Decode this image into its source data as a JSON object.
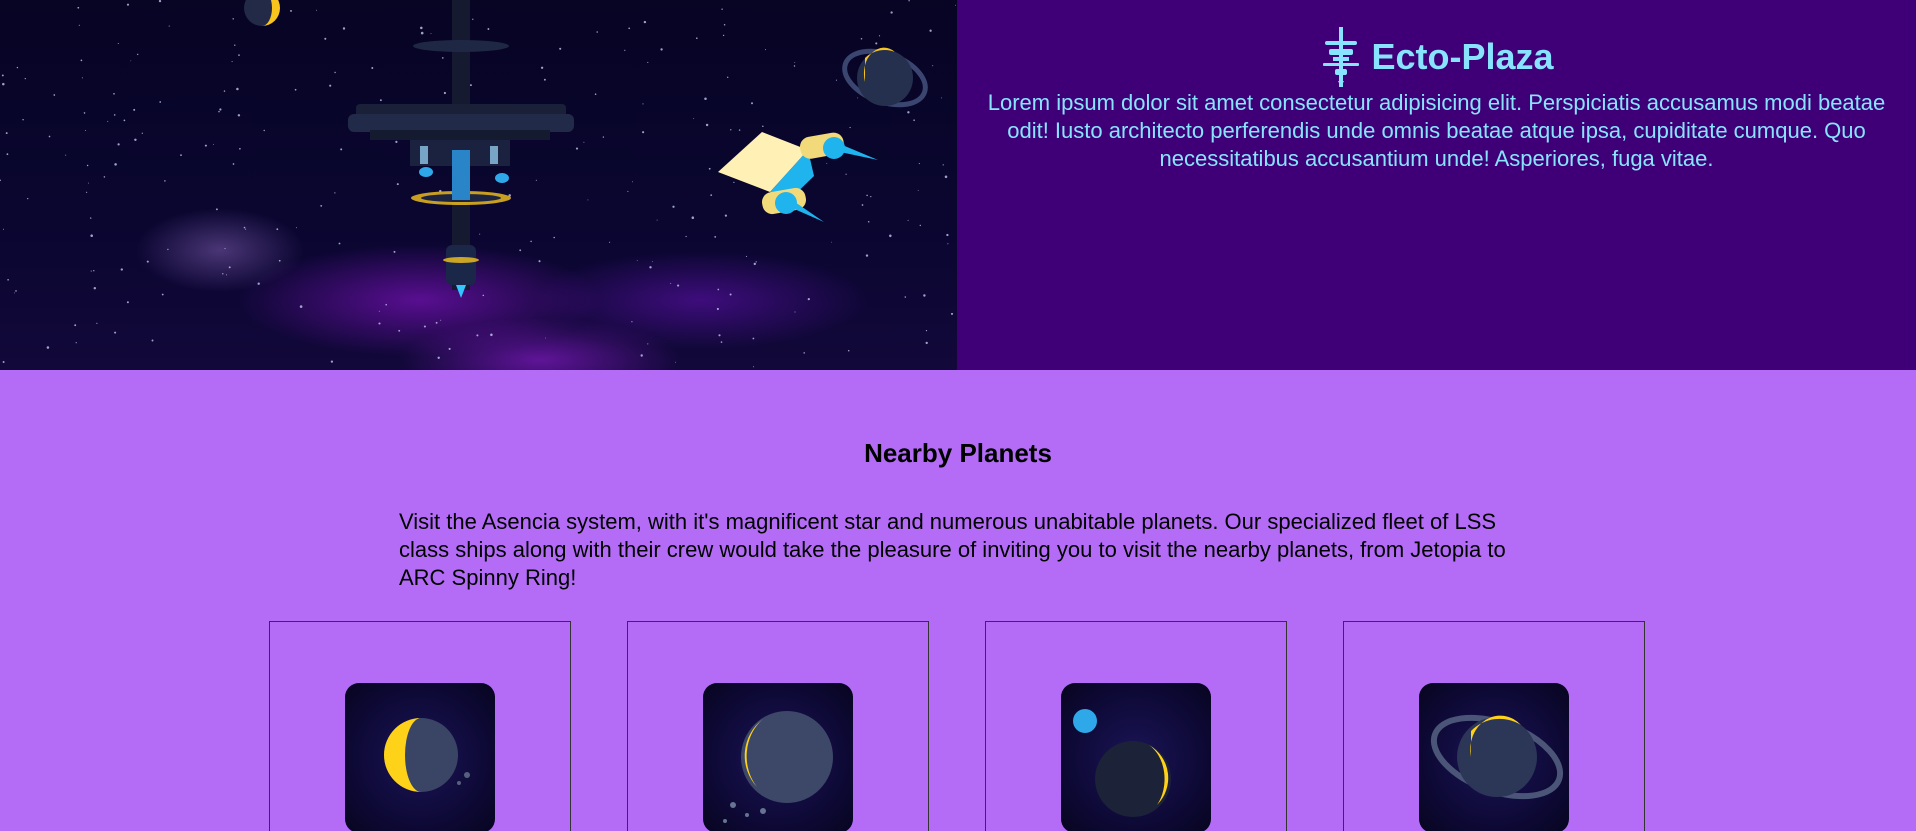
{
  "header": {
    "brand_title": "Ecto-Plaza",
    "brand_logo_icon": "space-station-icon",
    "intro": "Lorem ipsum dolor sit amet consectetur adipisicing elit. Perspiciatis accusamus modi beatae odit! Iusto architecto perferendis unde omnis beatae atque ipsa, cupiditate cumque. Quo necessitatibus accusantium unde! Asperiores, fuga vitae."
  },
  "planets_section": {
    "title": "Nearby Planets",
    "description": "Visit the Asencia system, with it's magnificent star and numerous unabitable planets. Our specialized fleet of LSS class ships along with their crew would take the pleasure of inviting you to visit the nearby planets, from Jetopia to ARC Spinny Ring!",
    "cards": [
      {
        "image": "planet-image"
      },
      {
        "image": "planet-image"
      },
      {
        "image": "planet-with-moon-image"
      },
      {
        "image": "ringed-planet-image"
      }
    ]
  },
  "colors": {
    "hero_panel": "#3f0077",
    "hero_text": "#88e3ff",
    "section_bg": "#b46cf7",
    "planet_glow": "#ffd21a"
  }
}
